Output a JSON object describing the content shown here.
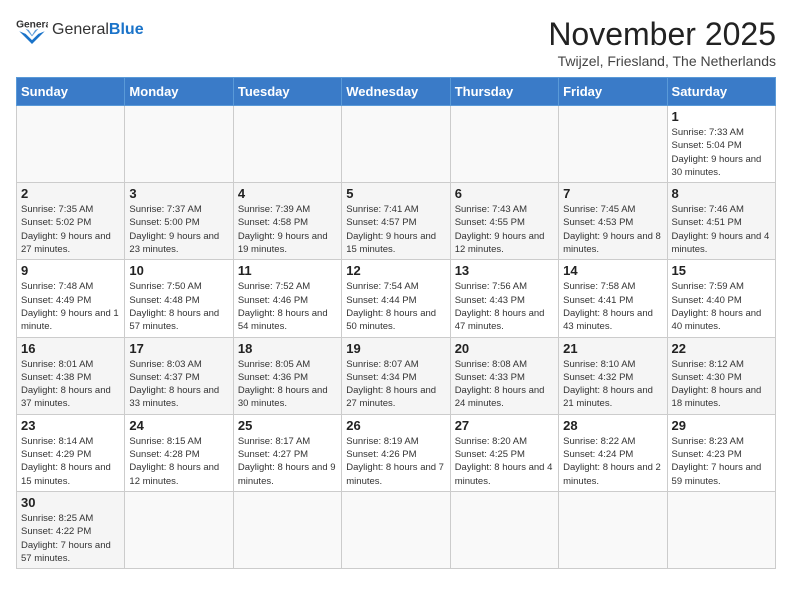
{
  "header": {
    "logo_general": "General",
    "logo_blue": "Blue",
    "month_title": "November 2025",
    "subtitle": "Twijzel, Friesland, The Netherlands"
  },
  "weekdays": [
    "Sunday",
    "Monday",
    "Tuesday",
    "Wednesday",
    "Thursday",
    "Friday",
    "Saturday"
  ],
  "days": [
    {
      "num": "",
      "info": ""
    },
    {
      "num": "",
      "info": ""
    },
    {
      "num": "",
      "info": ""
    },
    {
      "num": "",
      "info": ""
    },
    {
      "num": "",
      "info": ""
    },
    {
      "num": "",
      "info": ""
    },
    {
      "num": "1",
      "info": "Sunrise: 7:33 AM\nSunset: 5:04 PM\nDaylight: 9 hours and 30 minutes."
    },
    {
      "num": "2",
      "info": "Sunrise: 7:35 AM\nSunset: 5:02 PM\nDaylight: 9 hours and 27 minutes."
    },
    {
      "num": "3",
      "info": "Sunrise: 7:37 AM\nSunset: 5:00 PM\nDaylight: 9 hours and 23 minutes."
    },
    {
      "num": "4",
      "info": "Sunrise: 7:39 AM\nSunset: 4:58 PM\nDaylight: 9 hours and 19 minutes."
    },
    {
      "num": "5",
      "info": "Sunrise: 7:41 AM\nSunset: 4:57 PM\nDaylight: 9 hours and 15 minutes."
    },
    {
      "num": "6",
      "info": "Sunrise: 7:43 AM\nSunset: 4:55 PM\nDaylight: 9 hours and 12 minutes."
    },
    {
      "num": "7",
      "info": "Sunrise: 7:45 AM\nSunset: 4:53 PM\nDaylight: 9 hours and 8 minutes."
    },
    {
      "num": "8",
      "info": "Sunrise: 7:46 AM\nSunset: 4:51 PM\nDaylight: 9 hours and 4 minutes."
    },
    {
      "num": "9",
      "info": "Sunrise: 7:48 AM\nSunset: 4:49 PM\nDaylight: 9 hours and 1 minute."
    },
    {
      "num": "10",
      "info": "Sunrise: 7:50 AM\nSunset: 4:48 PM\nDaylight: 8 hours and 57 minutes."
    },
    {
      "num": "11",
      "info": "Sunrise: 7:52 AM\nSunset: 4:46 PM\nDaylight: 8 hours and 54 minutes."
    },
    {
      "num": "12",
      "info": "Sunrise: 7:54 AM\nSunset: 4:44 PM\nDaylight: 8 hours and 50 minutes."
    },
    {
      "num": "13",
      "info": "Sunrise: 7:56 AM\nSunset: 4:43 PM\nDaylight: 8 hours and 47 minutes."
    },
    {
      "num": "14",
      "info": "Sunrise: 7:58 AM\nSunset: 4:41 PM\nDaylight: 8 hours and 43 minutes."
    },
    {
      "num": "15",
      "info": "Sunrise: 7:59 AM\nSunset: 4:40 PM\nDaylight: 8 hours and 40 minutes."
    },
    {
      "num": "16",
      "info": "Sunrise: 8:01 AM\nSunset: 4:38 PM\nDaylight: 8 hours and 37 minutes."
    },
    {
      "num": "17",
      "info": "Sunrise: 8:03 AM\nSunset: 4:37 PM\nDaylight: 8 hours and 33 minutes."
    },
    {
      "num": "18",
      "info": "Sunrise: 8:05 AM\nSunset: 4:36 PM\nDaylight: 8 hours and 30 minutes."
    },
    {
      "num": "19",
      "info": "Sunrise: 8:07 AM\nSunset: 4:34 PM\nDaylight: 8 hours and 27 minutes."
    },
    {
      "num": "20",
      "info": "Sunrise: 8:08 AM\nSunset: 4:33 PM\nDaylight: 8 hours and 24 minutes."
    },
    {
      "num": "21",
      "info": "Sunrise: 8:10 AM\nSunset: 4:32 PM\nDaylight: 8 hours and 21 minutes."
    },
    {
      "num": "22",
      "info": "Sunrise: 8:12 AM\nSunset: 4:30 PM\nDaylight: 8 hours and 18 minutes."
    },
    {
      "num": "23",
      "info": "Sunrise: 8:14 AM\nSunset: 4:29 PM\nDaylight: 8 hours and 15 minutes."
    },
    {
      "num": "24",
      "info": "Sunrise: 8:15 AM\nSunset: 4:28 PM\nDaylight: 8 hours and 12 minutes."
    },
    {
      "num": "25",
      "info": "Sunrise: 8:17 AM\nSunset: 4:27 PM\nDaylight: 8 hours and 9 minutes."
    },
    {
      "num": "26",
      "info": "Sunrise: 8:19 AM\nSunset: 4:26 PM\nDaylight: 8 hours and 7 minutes."
    },
    {
      "num": "27",
      "info": "Sunrise: 8:20 AM\nSunset: 4:25 PM\nDaylight: 8 hours and 4 minutes."
    },
    {
      "num": "28",
      "info": "Sunrise: 8:22 AM\nSunset: 4:24 PM\nDaylight: 8 hours and 2 minutes."
    },
    {
      "num": "29",
      "info": "Sunrise: 8:23 AM\nSunset: 4:23 PM\nDaylight: 7 hours and 59 minutes."
    },
    {
      "num": "30",
      "info": "Sunrise: 8:25 AM\nSunset: 4:22 PM\nDaylight: 7 hours and 57 minutes."
    },
    {
      "num": "",
      "info": ""
    },
    {
      "num": "",
      "info": ""
    },
    {
      "num": "",
      "info": ""
    },
    {
      "num": "",
      "info": ""
    },
    {
      "num": "",
      "info": ""
    },
    {
      "num": "",
      "info": ""
    }
  ]
}
